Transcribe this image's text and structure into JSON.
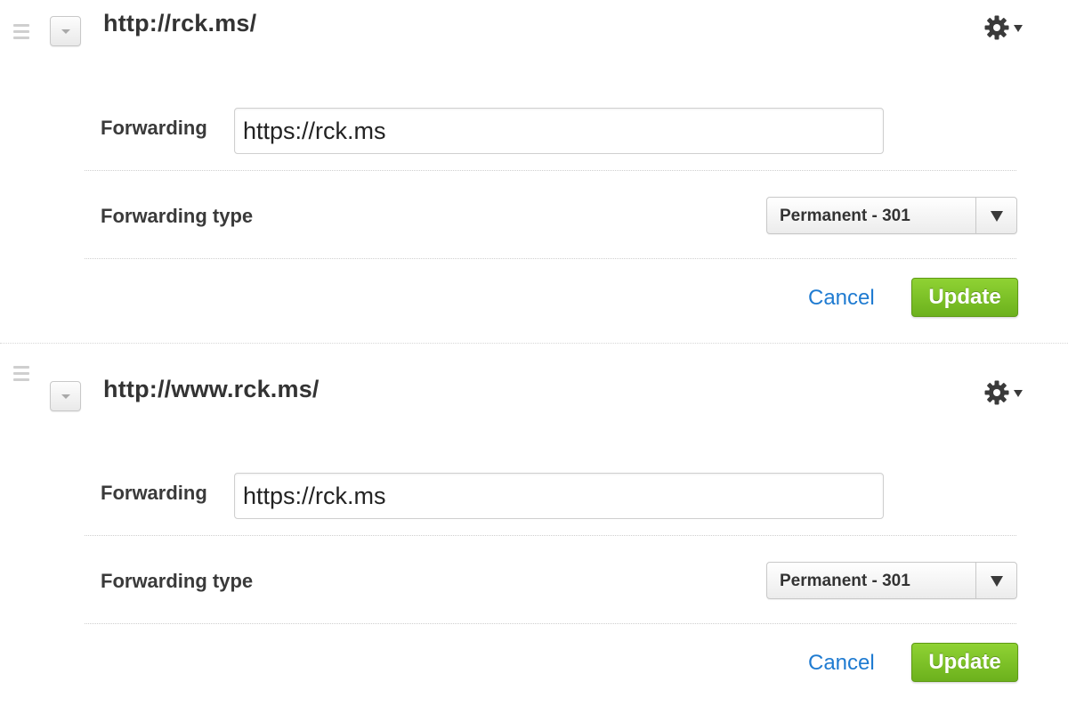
{
  "colors": {
    "link": "#1f7bd1",
    "update_button": "#7cc228",
    "label_text": "#3a3a3a"
  },
  "rules": [
    {
      "url": "http://rck.ms/",
      "forwarding_label": "Forwarding",
      "forwarding_value": "https://rck.ms",
      "type_label": "Forwarding type",
      "type_value": "Permanent - 301",
      "cancel_label": "Cancel",
      "update_label": "Update",
      "icons": [
        "drag-handle-icon",
        "collapse-caret-icon",
        "gear-icon",
        "caret-down-icon"
      ]
    },
    {
      "url": "http://www.rck.ms/",
      "forwarding_label": "Forwarding",
      "forwarding_value": "https://rck.ms",
      "type_label": "Forwarding type",
      "type_value": "Permanent - 301",
      "cancel_label": "Cancel",
      "update_label": "Update",
      "icons": [
        "drag-handle-icon",
        "collapse-caret-icon",
        "gear-icon",
        "caret-down-icon"
      ]
    }
  ]
}
